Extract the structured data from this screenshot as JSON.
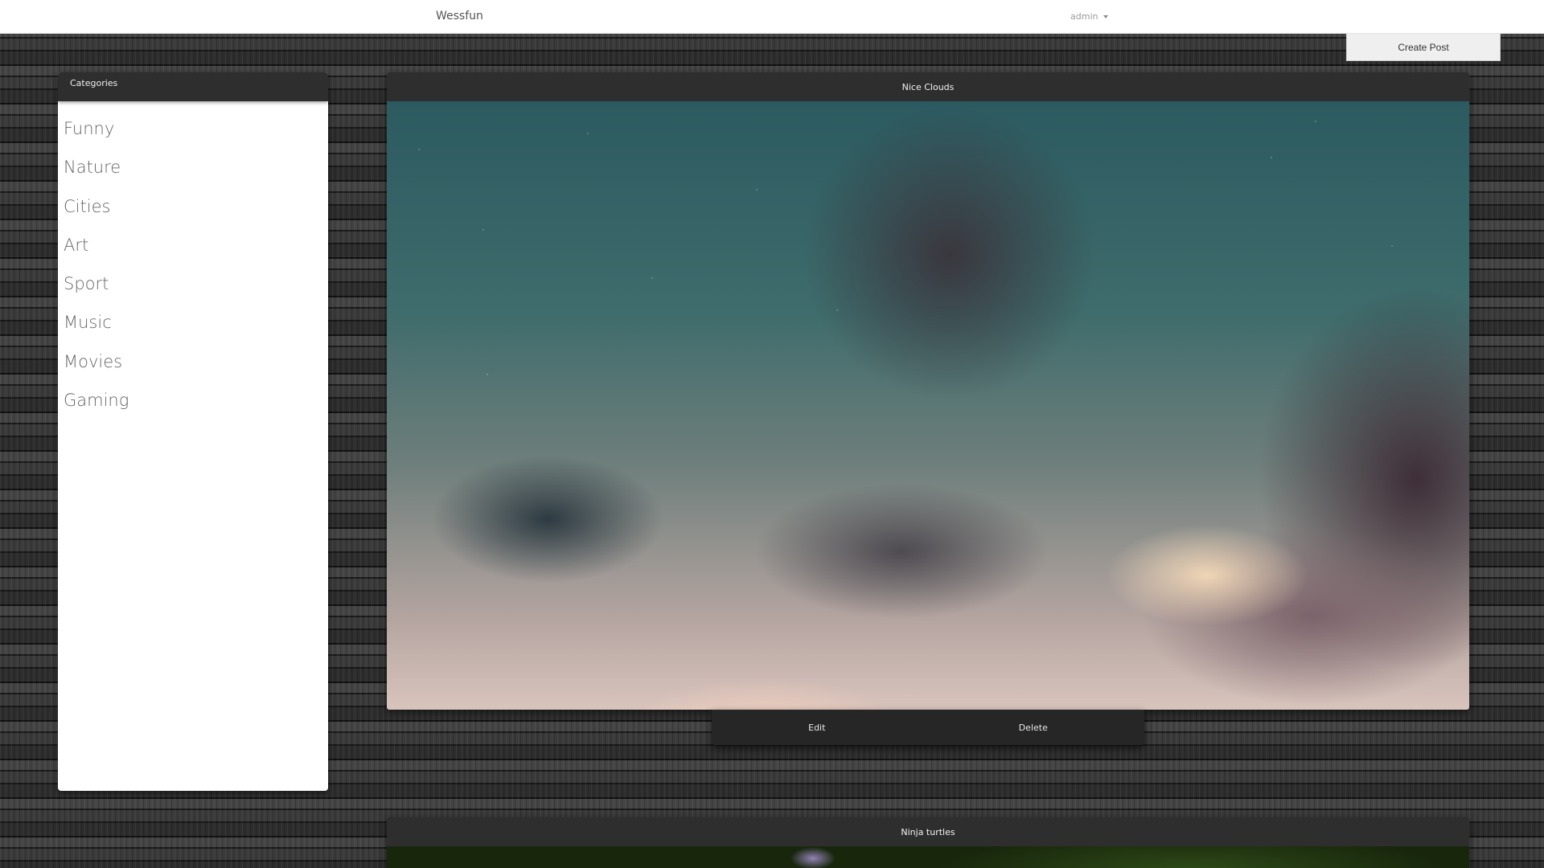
{
  "navbar": {
    "brand": "Wessfun",
    "user": "admin",
    "caret_icon": "caret-down-icon"
  },
  "create_post_label": "Create Post",
  "categories": {
    "title": "Categories",
    "items": [
      "Funny",
      "Nature",
      "Cities",
      "Art",
      "Sport",
      "Music",
      "Movies",
      "Gaming"
    ]
  },
  "posts": [
    {
      "title": "Nice Clouds",
      "actions": {
        "edit": "Edit",
        "delete": "Delete"
      }
    },
    {
      "title": "Ninja turtles"
    }
  ],
  "colors": {
    "navbar_bg": "#ffffff",
    "header_bg": "#2e2e2e",
    "panel_bg": "#ffffff",
    "category_text": "#666666"
  }
}
